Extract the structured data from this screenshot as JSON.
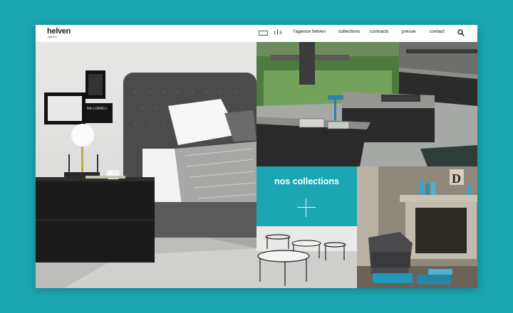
{
  "header": {
    "logo": {
      "name": "helven",
      "tagline": "agence"
    },
    "pager": {
      "current": "1",
      "total": "5"
    },
    "nav": [
      {
        "label": "l'agence helven"
      },
      {
        "label": "collections"
      },
      {
        "label": "contracts"
      },
      {
        "label": "presse"
      },
      {
        "label": "contact"
      }
    ],
    "search_icon": "search-icon"
  },
  "feature": {
    "title": "nos collections",
    "icon": "plus-icon"
  },
  "bedroom_art": {
    "poster_text": "NA.LOMAC+"
  },
  "living_art": {
    "letter": "D"
  },
  "colors": {
    "background": "#1aa7b3",
    "accent": "#1aa7b3",
    "text": "#111111"
  }
}
